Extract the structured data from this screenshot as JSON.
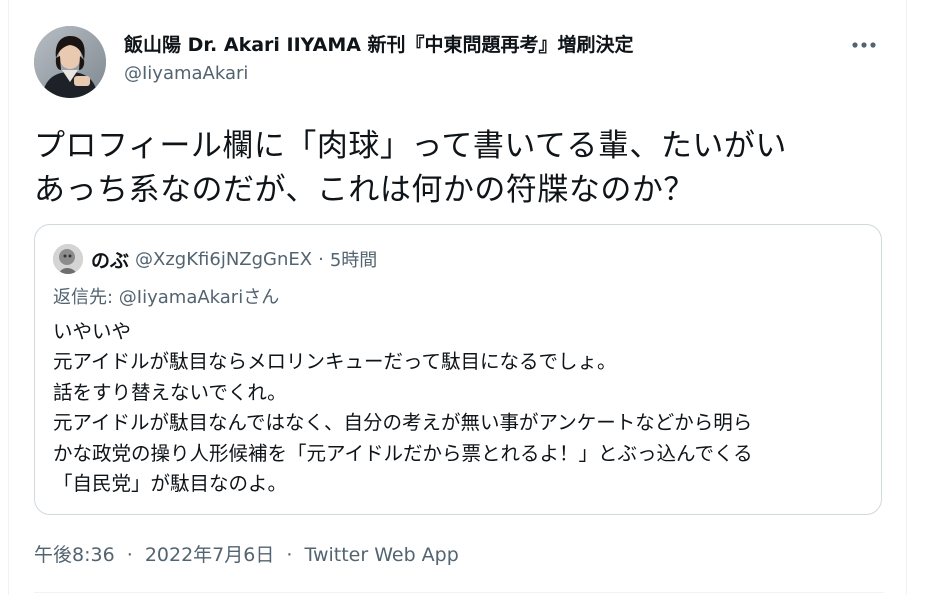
{
  "tweet": {
    "author": {
      "display_name": "飯山陽 Dr. Akari IIYAMA 新刊『中東問題再考』増刷決定",
      "handle": "@IiyamaAkari"
    },
    "text_lines": [
      "プロフィール欄に「肉球」って書いてる輩、たいがい",
      "あっち系なのだが、これは何かの符牒なのか？"
    ],
    "quoted": {
      "name": "のぶ",
      "handle": "@XzgKfi6jNZgGnEX",
      "dot": "·",
      "time": "5時間",
      "reply_prefix": "返信先: ",
      "reply_mention": "@IiyamaAkari",
      "reply_suffix": "さん",
      "body_lines": [
        "いやいや",
        "元アイドルが駄目ならメロリンキューだって駄目になるでしょ。",
        "話をすり替えないでくれ。",
        "元アイドルが駄目なんではなく、自分の考えが無い事がアンケートなどから明ら",
        "かな政党の操り人形候補を「元アイドルだから票とれるよ！」とぶっ込んでくる",
        "「自民党」が駄目なのよ。"
      ]
    },
    "meta": {
      "time": "午後8:36",
      "sep1": "·",
      "date": "2022年7月6日",
      "sep2": "·",
      "source": "Twitter Web App"
    }
  },
  "icons": {
    "more": "more-horizontal-icon"
  },
  "colors": {
    "text_primary": "#0f1419",
    "text_secondary": "#536471",
    "border": "#cfd9de"
  }
}
